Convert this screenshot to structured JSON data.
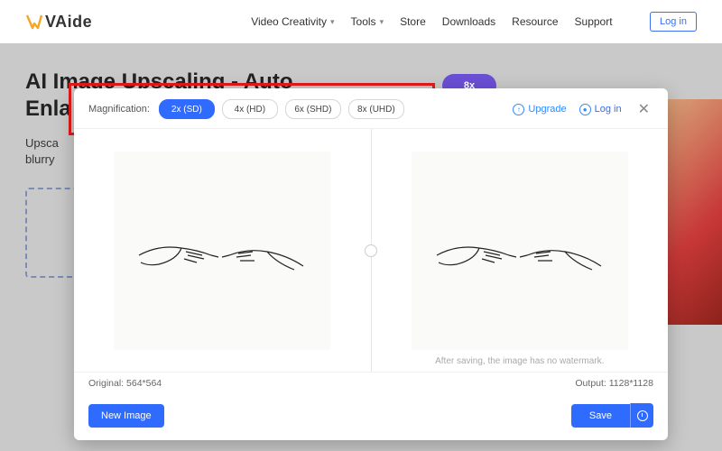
{
  "nav": {
    "brand": "VAide",
    "items": [
      "Video Creativity",
      "Tools",
      "Store",
      "Downloads",
      "Resource",
      "Support"
    ],
    "login": "Log in"
  },
  "bg": {
    "title_line1": "AI Image Upscaling - Auto",
    "title_line2": "Enla",
    "sub_line1": "Upsca",
    "sub_line2": "blurry",
    "pill": "8x"
  },
  "modal": {
    "mag_label": "Magnification:",
    "options": [
      {
        "label": "2x (SD)",
        "active": true
      },
      {
        "label": "4x (HD)",
        "active": false
      },
      {
        "label": "6x (SHD)",
        "active": false
      },
      {
        "label": "8x (UHD)",
        "active": false
      }
    ],
    "upgrade": "Upgrade",
    "login": "Log in",
    "watermark_note": "After saving, the image has no watermark.",
    "original_label": "Original: 564*564",
    "output_label": "Output: 1128*1128",
    "new_image": "New Image",
    "save": "Save"
  },
  "colors": {
    "accent": "#2f6bff",
    "highlight": "#e61919"
  }
}
